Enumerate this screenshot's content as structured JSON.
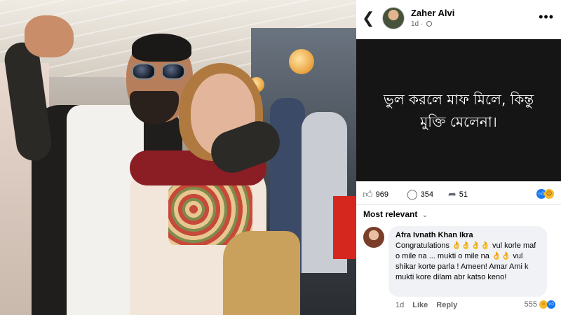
{
  "post": {
    "author": "Zaher Alvi",
    "time": "1d",
    "text": "ভুল করলে মাফ মিলে, কিন্তু মুক্তি মেলেনা।"
  },
  "stats": {
    "likes": "969",
    "comments": "354",
    "shares": "51"
  },
  "comments_section": {
    "sort_label": "Most relevant"
  },
  "comment": {
    "author": "Afra Ivnath Khan Ikra",
    "text": "Congratulations 👌👌👌👌 vul korle maf o mile na ... mukti o mile na 👌👌 vul shikar korte parla ! Ameen! Amar Ami k mukti kore dilam abr katso keno!",
    "time": "1d",
    "like_label": "Like",
    "reply_label": "Reply",
    "reaction_count": "555"
  },
  "icons": {
    "back": "chevron-left-icon",
    "more": "more-icon",
    "like": "thumbs-up-icon",
    "comment": "comment-icon",
    "share": "share-icon",
    "globe": "globe-icon"
  },
  "colors": {
    "post_background": "#151515",
    "facebook_blue": "#1877f2",
    "secondary_text": "#65676b",
    "bubble": "#f0f2f5"
  }
}
